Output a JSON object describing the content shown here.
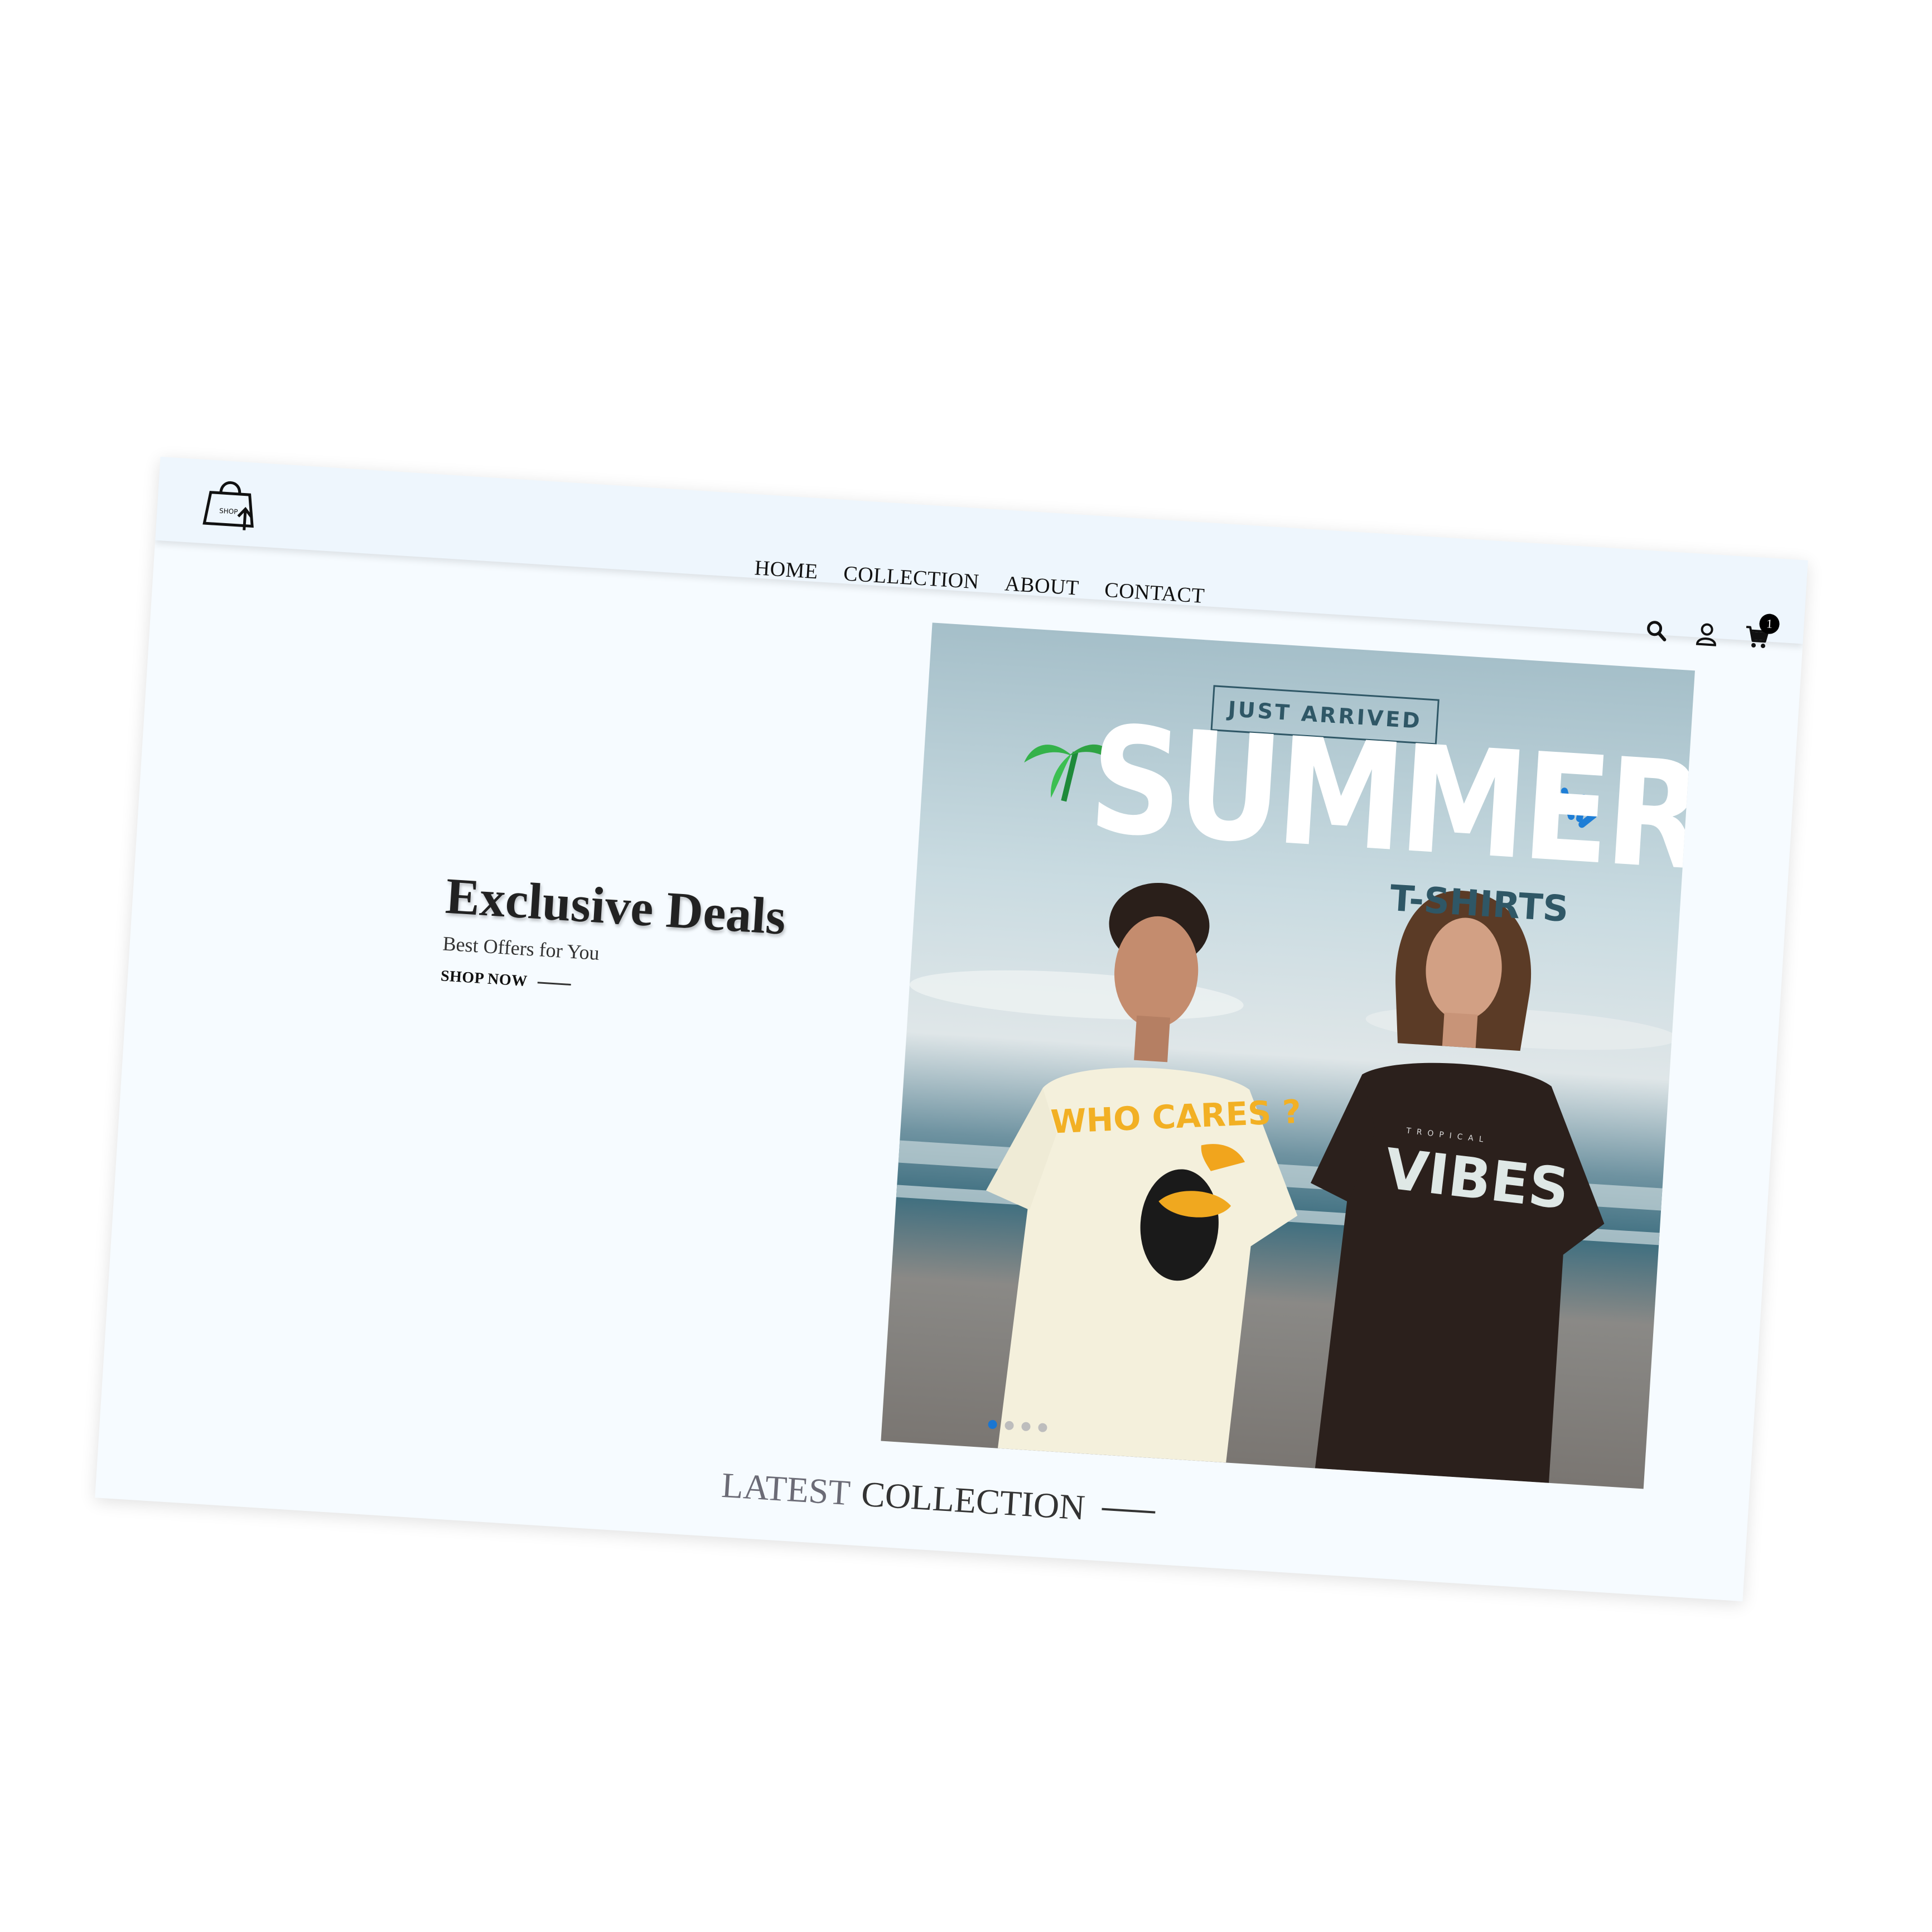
{
  "header": {
    "logo_text": "SHOP",
    "nav": [
      {
        "label": "HOME"
      },
      {
        "label": "COLLECTION"
      },
      {
        "label": "ABOUT"
      },
      {
        "label": "CONTACT"
      }
    ],
    "cart_count": "1",
    "icons": [
      "search-icon",
      "user-icon",
      "cart-icon"
    ]
  },
  "hero": {
    "title": "Exclusive Deals",
    "subtitle": "Best Offers for You",
    "cta_label": "SHOP NOW"
  },
  "banner": {
    "tag": "JUST ARRIVED",
    "headline": "SUMMER",
    "subheadline": "T-SHIRTS",
    "shirt_left_text": "WHO CARES ?",
    "shirt_right_small": "TROPICAL",
    "shirt_right_text": "VIBES",
    "slides": 4,
    "active_slide": 1
  },
  "section": {
    "title_part1": "LATEST",
    "title_part2": "COLLECTION"
  },
  "colors": {
    "page_bg": "#f6fbff",
    "header_bg": "#eef6fd",
    "accent": "#1976d2",
    "banner_dark": "#2f5766"
  }
}
